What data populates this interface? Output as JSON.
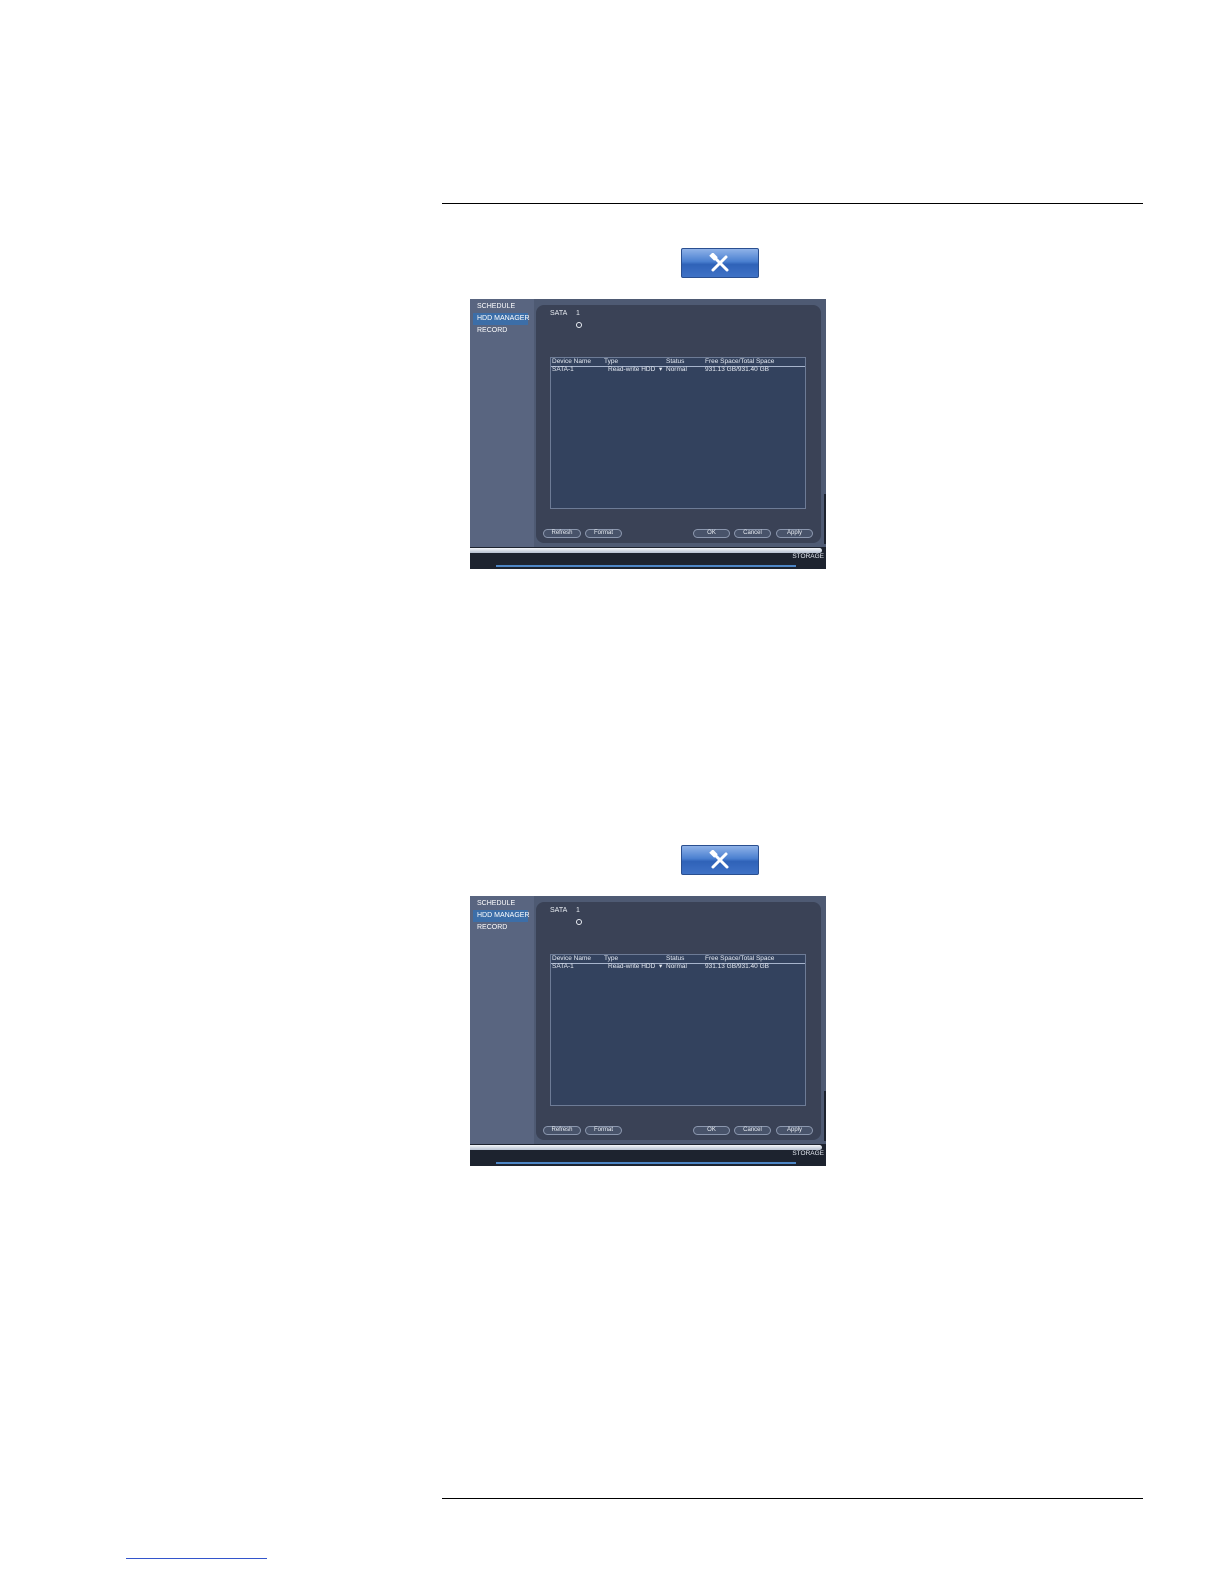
{
  "tool_icon": "tools-icon",
  "panel": {
    "sidebar": [
      {
        "label": "SCHEDULE",
        "active": false
      },
      {
        "label": "HDD MANAGER",
        "active": true
      },
      {
        "label": "RECORD",
        "active": false
      }
    ],
    "sata_label": "SATA",
    "sata_number": "1",
    "columns": [
      "Device Name",
      "Type",
      "Status",
      "Free Space/Total Space"
    ],
    "rows": [
      {
        "device": "SATA-1",
        "type": "Read-write HDD",
        "status": "Normal",
        "space": "931.13 GB/931.40 GB"
      }
    ],
    "buttons": {
      "refresh": "Refresh",
      "format": "Format",
      "ok": "OK",
      "cancel": "Cancel",
      "apply": "Apply"
    },
    "footer_label": "STORAGE"
  },
  "colors": {
    "panel_bg": "#4e5a73",
    "content_bg": "#3a4256",
    "table_bg": "#33425e",
    "active_item": "#3c6ea8",
    "tool_button": "#3f72c6"
  }
}
